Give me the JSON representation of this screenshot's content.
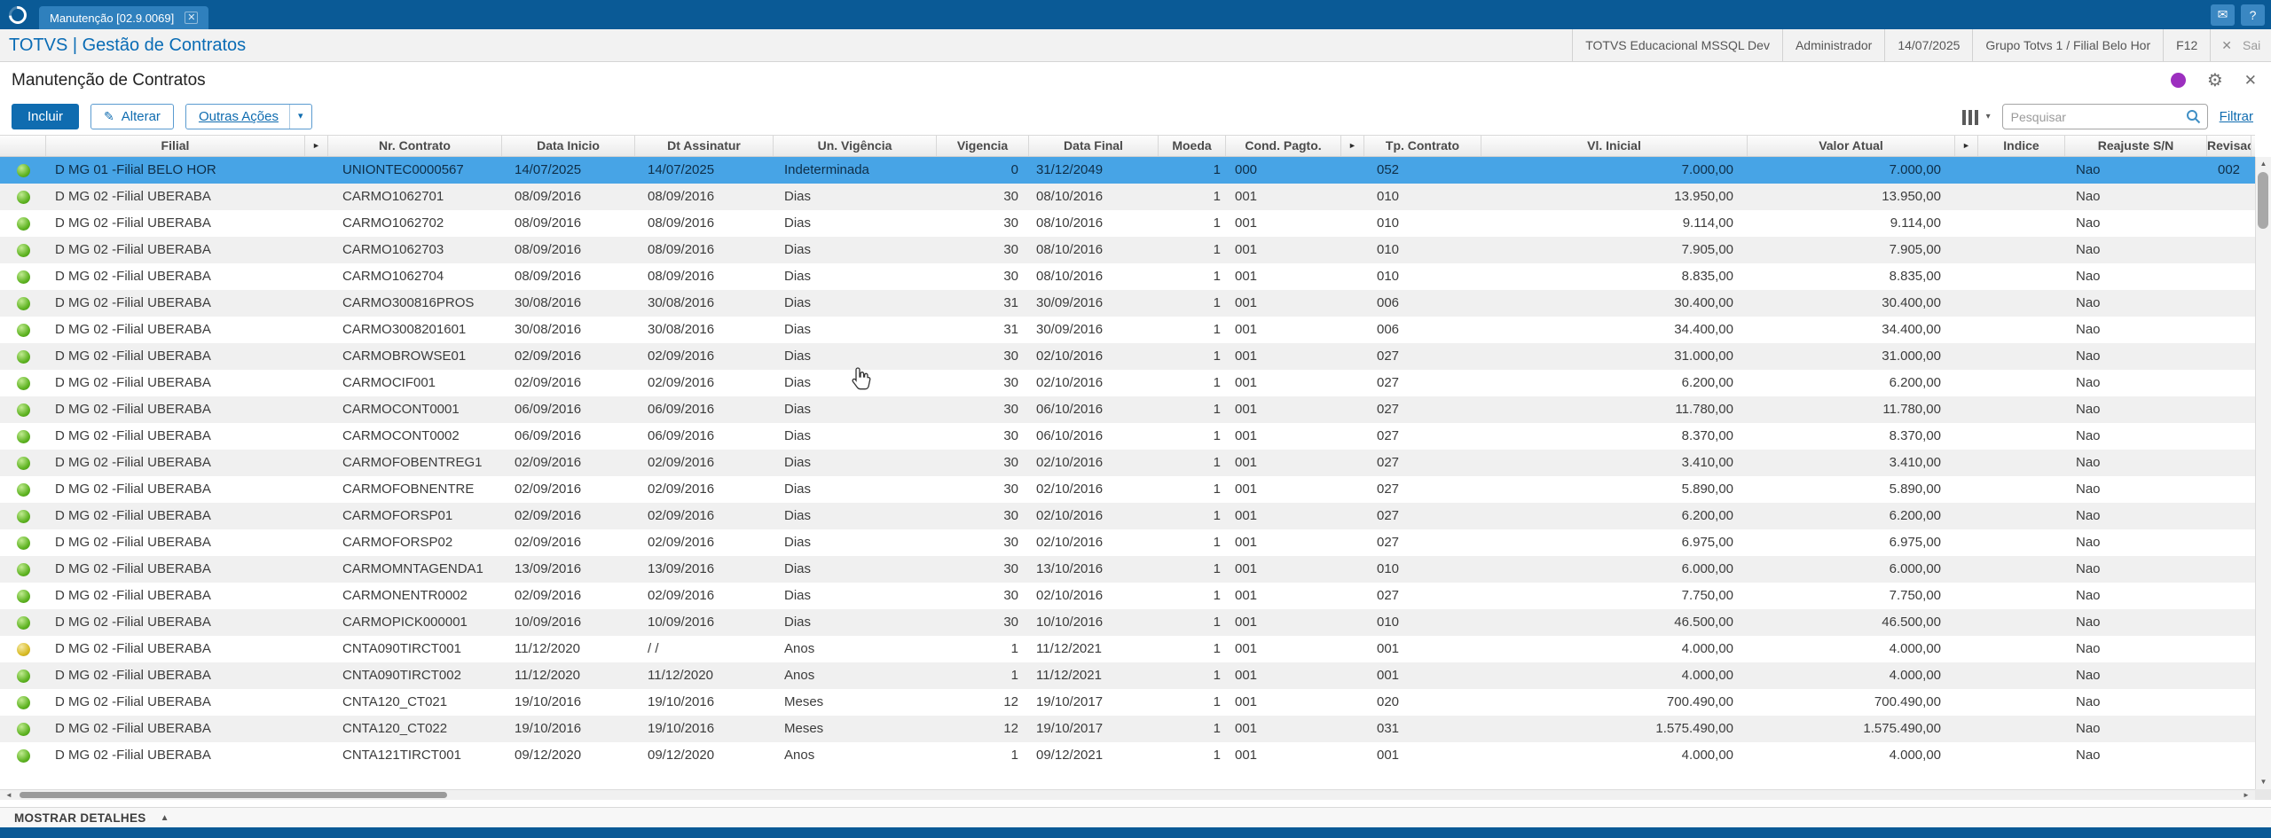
{
  "top_bar": {
    "tab_label": "Manutenção [02.9.0069]",
    "tab_close_glyph": "✕",
    "mail_icon_glyph": "✉",
    "help_icon_glyph": "?"
  },
  "header": {
    "brand": "TOTVS | Gestão de Contratos",
    "environment": "TOTVS Educacional MSSQL Dev",
    "user": "Administrador",
    "date": "14/07/2025",
    "group_branch": "Grupo Totvs 1 / Filial Belo Hor",
    "f12": "F12",
    "close_glyph": "✕",
    "exit_label": "Sai"
  },
  "page": {
    "title": "Manutenção de Contratos"
  },
  "toolbar": {
    "incluir_label": "Incluir",
    "alterar_label": "Alterar",
    "pencil_glyph": "✎",
    "outras_acoes_label": "Outras Ações",
    "caret_glyph": "▾",
    "search_placeholder": "Pesquisar",
    "filtrar_label": "Filtrar"
  },
  "table": {
    "expand_glyph": "►",
    "headers": {
      "filial": "Filial",
      "contrato": "Nr. Contrato",
      "data_inicio": "Data Inicio",
      "dt_assinatur": "Dt Assinatur",
      "un_vigencia": "Un. Vigência",
      "vigencia": "Vigencia",
      "data_final": "Data Final",
      "moeda": "Moeda",
      "cond_pagto": "Cond. Pagto.",
      "tp_contrato": "Tp. Contrato",
      "vl_inicial": "Vl. Inicial",
      "valor_atual": "Valor Atual",
      "indice": "Indice",
      "reajuste": "Reajuste S/N",
      "revisao": "Revisao"
    },
    "rows": [
      {
        "status": "green",
        "selected": true,
        "filial": "D MG 01 -Filial BELO HOR",
        "contrato": "UNIONTEC0000567",
        "data_inicio": "14/07/2025",
        "dt_assinatur": "14/07/2025",
        "un_vigencia": "Indeterminada",
        "vigencia": "0",
        "data_final": "31/12/2049",
        "moeda": "1",
        "cond_pagto": "000",
        "tp_contrato": "052",
        "vl_inicial": "7.000,00",
        "valor_atual": "7.000,00",
        "indice": "",
        "reajuste": "Nao",
        "revisao": "002"
      },
      {
        "status": "green",
        "filial": "D MG 02 -Filial UBERABA",
        "contrato": "CARMO1062701",
        "data_inicio": "08/09/2016",
        "dt_assinatur": "08/09/2016",
        "un_vigencia": "Dias",
        "vigencia": "30",
        "data_final": "08/10/2016",
        "moeda": "1",
        "cond_pagto": "001",
        "tp_contrato": "010",
        "vl_inicial": "13.950,00",
        "valor_atual": "13.950,00",
        "indice": "",
        "reajuste": "Nao",
        "revisao": ""
      },
      {
        "status": "green",
        "filial": "D MG 02 -Filial UBERABA",
        "contrato": "CARMO1062702",
        "data_inicio": "08/09/2016",
        "dt_assinatur": "08/09/2016",
        "un_vigencia": "Dias",
        "vigencia": "30",
        "data_final": "08/10/2016",
        "moeda": "1",
        "cond_pagto": "001",
        "tp_contrato": "010",
        "vl_inicial": "9.114,00",
        "valor_atual": "9.114,00",
        "indice": "",
        "reajuste": "Nao",
        "revisao": ""
      },
      {
        "status": "green",
        "filial": "D MG 02 -Filial UBERABA",
        "contrato": "CARMO1062703",
        "data_inicio": "08/09/2016",
        "dt_assinatur": "08/09/2016",
        "un_vigencia": "Dias",
        "vigencia": "30",
        "data_final": "08/10/2016",
        "moeda": "1",
        "cond_pagto": "001",
        "tp_contrato": "010",
        "vl_inicial": "7.905,00",
        "valor_atual": "7.905,00",
        "indice": "",
        "reajuste": "Nao",
        "revisao": ""
      },
      {
        "status": "green",
        "filial": "D MG 02 -Filial UBERABA",
        "contrato": "CARMO1062704",
        "data_inicio": "08/09/2016",
        "dt_assinatur": "08/09/2016",
        "un_vigencia": "Dias",
        "vigencia": "30",
        "data_final": "08/10/2016",
        "moeda": "1",
        "cond_pagto": "001",
        "tp_contrato": "010",
        "vl_inicial": "8.835,00",
        "valor_atual": "8.835,00",
        "indice": "",
        "reajuste": "Nao",
        "revisao": ""
      },
      {
        "status": "green",
        "filial": "D MG 02 -Filial UBERABA",
        "contrato": "CARMO300816PROS",
        "data_inicio": "30/08/2016",
        "dt_assinatur": "30/08/2016",
        "un_vigencia": "Dias",
        "vigencia": "31",
        "data_final": "30/09/2016",
        "moeda": "1",
        "cond_pagto": "001",
        "tp_contrato": "006",
        "vl_inicial": "30.400,00",
        "valor_atual": "30.400,00",
        "indice": "",
        "reajuste": "Nao",
        "revisao": ""
      },
      {
        "status": "green",
        "filial": "D MG 02 -Filial UBERABA",
        "contrato": "CARMO3008201601",
        "data_inicio": "30/08/2016",
        "dt_assinatur": "30/08/2016",
        "un_vigencia": "Dias",
        "vigencia": "31",
        "data_final": "30/09/2016",
        "moeda": "1",
        "cond_pagto": "001",
        "tp_contrato": "006",
        "vl_inicial": "34.400,00",
        "valor_atual": "34.400,00",
        "indice": "",
        "reajuste": "Nao",
        "revisao": ""
      },
      {
        "status": "green",
        "filial": "D MG 02 -Filial UBERABA",
        "contrato": "CARMOBROWSE01",
        "data_inicio": "02/09/2016",
        "dt_assinatur": "02/09/2016",
        "un_vigencia": "Dias",
        "vigencia": "30",
        "data_final": "02/10/2016",
        "moeda": "1",
        "cond_pagto": "001",
        "tp_contrato": "027",
        "vl_inicial": "31.000,00",
        "valor_atual": "31.000,00",
        "indice": "",
        "reajuste": "Nao",
        "revisao": ""
      },
      {
        "status": "green",
        "filial": "D MG 02 -Filial UBERABA",
        "contrato": "CARMOCIF001",
        "data_inicio": "02/09/2016",
        "dt_assinatur": "02/09/2016",
        "un_vigencia": "Dias",
        "vigencia": "30",
        "data_final": "02/10/2016",
        "moeda": "1",
        "cond_pagto": "001",
        "tp_contrato": "027",
        "vl_inicial": "6.200,00",
        "valor_atual": "6.200,00",
        "indice": "",
        "reajuste": "Nao",
        "revisao": ""
      },
      {
        "status": "green",
        "filial": "D MG 02 -Filial UBERABA",
        "contrato": "CARMOCONT0001",
        "data_inicio": "06/09/2016",
        "dt_assinatur": "06/09/2016",
        "un_vigencia": "Dias",
        "vigencia": "30",
        "data_final": "06/10/2016",
        "moeda": "1",
        "cond_pagto": "001",
        "tp_contrato": "027",
        "vl_inicial": "11.780,00",
        "valor_atual": "11.780,00",
        "indice": "",
        "reajuste": "Nao",
        "revisao": ""
      },
      {
        "status": "green",
        "filial": "D MG 02 -Filial UBERABA",
        "contrato": "CARMOCONT0002",
        "data_inicio": "06/09/2016",
        "dt_assinatur": "06/09/2016",
        "un_vigencia": "Dias",
        "vigencia": "30",
        "data_final": "06/10/2016",
        "moeda": "1",
        "cond_pagto": "001",
        "tp_contrato": "027",
        "vl_inicial": "8.370,00",
        "valor_atual": "8.370,00",
        "indice": "",
        "reajuste": "Nao",
        "revisao": ""
      },
      {
        "status": "green",
        "filial": "D MG 02 -Filial UBERABA",
        "contrato": "CARMOFOBENTREG1",
        "data_inicio": "02/09/2016",
        "dt_assinatur": "02/09/2016",
        "un_vigencia": "Dias",
        "vigencia": "30",
        "data_final": "02/10/2016",
        "moeda": "1",
        "cond_pagto": "001",
        "tp_contrato": "027",
        "vl_inicial": "3.410,00",
        "valor_atual": "3.410,00",
        "indice": "",
        "reajuste": "Nao",
        "revisao": ""
      },
      {
        "status": "green",
        "filial": "D MG 02 -Filial UBERABA",
        "contrato": "CARMOFOBNENTRE",
        "data_inicio": "02/09/2016",
        "dt_assinatur": "02/09/2016",
        "un_vigencia": "Dias",
        "vigencia": "30",
        "data_final": "02/10/2016",
        "moeda": "1",
        "cond_pagto": "001",
        "tp_contrato": "027",
        "vl_inicial": "5.890,00",
        "valor_atual": "5.890,00",
        "indice": "",
        "reajuste": "Nao",
        "revisao": ""
      },
      {
        "status": "green",
        "filial": "D MG 02 -Filial UBERABA",
        "contrato": "CARMOFORSP01",
        "data_inicio": "02/09/2016",
        "dt_assinatur": "02/09/2016",
        "un_vigencia": "Dias",
        "vigencia": "30",
        "data_final": "02/10/2016",
        "moeda": "1",
        "cond_pagto": "001",
        "tp_contrato": "027",
        "vl_inicial": "6.200,00",
        "valor_atual": "6.200,00",
        "indice": "",
        "reajuste": "Nao",
        "revisao": ""
      },
      {
        "status": "green",
        "filial": "D MG 02 -Filial UBERABA",
        "contrato": "CARMOFORSP02",
        "data_inicio": "02/09/2016",
        "dt_assinatur": "02/09/2016",
        "un_vigencia": "Dias",
        "vigencia": "30",
        "data_final": "02/10/2016",
        "moeda": "1",
        "cond_pagto": "001",
        "tp_contrato": "027",
        "vl_inicial": "6.975,00",
        "valor_atual": "6.975,00",
        "indice": "",
        "reajuste": "Nao",
        "revisao": ""
      },
      {
        "status": "green",
        "filial": "D MG 02 -Filial UBERABA",
        "contrato": "CARMOMNTAGENDA1",
        "data_inicio": "13/09/2016",
        "dt_assinatur": "13/09/2016",
        "un_vigencia": "Dias",
        "vigencia": "30",
        "data_final": "13/10/2016",
        "moeda": "1",
        "cond_pagto": "001",
        "tp_contrato": "010",
        "vl_inicial": "6.000,00",
        "valor_atual": "6.000,00",
        "indice": "",
        "reajuste": "Nao",
        "revisao": ""
      },
      {
        "status": "green",
        "filial": "D MG 02 -Filial UBERABA",
        "contrato": "CARMONENTR0002",
        "data_inicio": "02/09/2016",
        "dt_assinatur": "02/09/2016",
        "un_vigencia": "Dias",
        "vigencia": "30",
        "data_final": "02/10/2016",
        "moeda": "1",
        "cond_pagto": "001",
        "tp_contrato": "027",
        "vl_inicial": "7.750,00",
        "valor_atual": "7.750,00",
        "indice": "",
        "reajuste": "Nao",
        "revisao": ""
      },
      {
        "status": "green",
        "filial": "D MG 02 -Filial UBERABA",
        "contrato": "CARMOPICK000001",
        "data_inicio": "10/09/2016",
        "dt_assinatur": "10/09/2016",
        "un_vigencia": "Dias",
        "vigencia": "30",
        "data_final": "10/10/2016",
        "moeda": "1",
        "cond_pagto": "001",
        "tp_contrato": "010",
        "vl_inicial": "46.500,00",
        "valor_atual": "46.500,00",
        "indice": "",
        "reajuste": "Nao",
        "revisao": ""
      },
      {
        "status": "yellow",
        "filial": "D MG 02 -Filial UBERABA",
        "contrato": "CNTA090TIRCT001",
        "data_inicio": "11/12/2020",
        "dt_assinatur": "/ /",
        "un_vigencia": "Anos",
        "vigencia": "1",
        "data_final": "11/12/2021",
        "moeda": "1",
        "cond_pagto": "001",
        "tp_contrato": "001",
        "vl_inicial": "4.000,00",
        "valor_atual": "4.000,00",
        "indice": "",
        "reajuste": "Nao",
        "revisao": ""
      },
      {
        "status": "green",
        "filial": "D MG 02 -Filial UBERABA",
        "contrato": "CNTA090TIRCT002",
        "data_inicio": "11/12/2020",
        "dt_assinatur": "11/12/2020",
        "un_vigencia": "Anos",
        "vigencia": "1",
        "data_final": "11/12/2021",
        "moeda": "1",
        "cond_pagto": "001",
        "tp_contrato": "001",
        "vl_inicial": "4.000,00",
        "valor_atual": "4.000,00",
        "indice": "",
        "reajuste": "Nao",
        "revisao": ""
      },
      {
        "status": "green",
        "filial": "D MG 02 -Filial UBERABA",
        "contrato": "CNTA120_CT021",
        "data_inicio": "19/10/2016",
        "dt_assinatur": "19/10/2016",
        "un_vigencia": "Meses",
        "vigencia": "12",
        "data_final": "19/10/2017",
        "moeda": "1",
        "cond_pagto": "001",
        "tp_contrato": "020",
        "vl_inicial": "700.490,00",
        "valor_atual": "700.490,00",
        "indice": "",
        "reajuste": "Nao",
        "revisao": ""
      },
      {
        "status": "green",
        "filial": "D MG 02 -Filial UBERABA",
        "contrato": "CNTA120_CT022",
        "data_inicio": "19/10/2016",
        "dt_assinatur": "19/10/2016",
        "un_vigencia": "Meses",
        "vigencia": "12",
        "data_final": "19/10/2017",
        "moeda": "1",
        "cond_pagto": "001",
        "tp_contrato": "031",
        "vl_inicial": "1.575.490,00",
        "valor_atual": "1.575.490,00",
        "indice": "",
        "reajuste": "Nao",
        "revisao": ""
      },
      {
        "status": "green",
        "filial": "D MG 02 -Filial UBERABA",
        "contrato": "CNTA121TIRCT001",
        "data_inicio": "09/12/2020",
        "dt_assinatur": "09/12/2020",
        "un_vigencia": "Anos",
        "vigencia": "1",
        "data_final": "09/12/2021",
        "moeda": "1",
        "cond_pagto": "001",
        "tp_contrato": "001",
        "vl_inicial": "4.000,00",
        "valor_atual": "4.000,00",
        "indice": "",
        "reajuste": "Nao",
        "revisao": ""
      }
    ]
  },
  "scrollbars": {
    "up_glyph": "▲",
    "down_glyph": "▼",
    "left_glyph": "◄",
    "right_glyph": "►"
  },
  "footer": {
    "mostrar_detalhes": "MOSTRAR DETALHES",
    "collapse_glyph": "▲"
  }
}
